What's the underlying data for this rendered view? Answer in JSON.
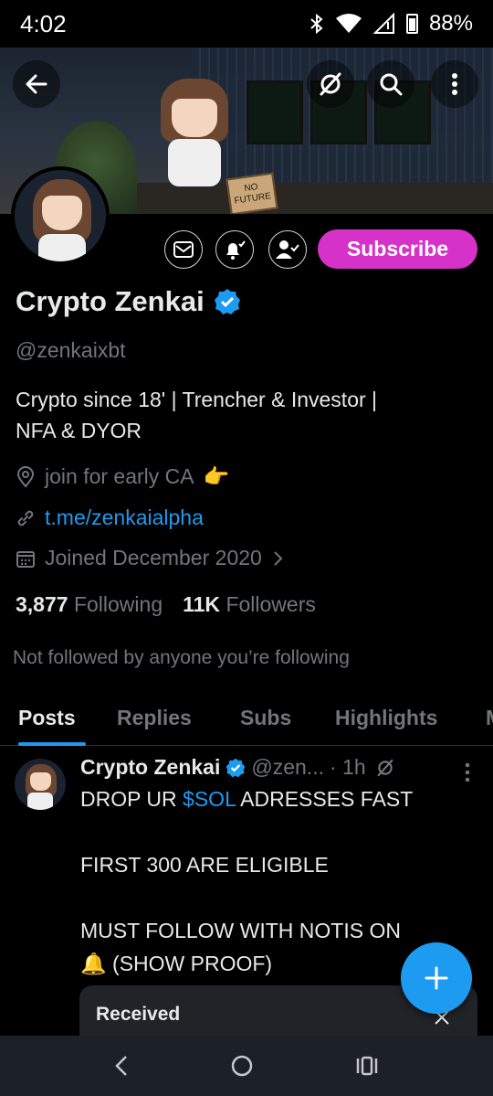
{
  "status_bar": {
    "time": "4:02",
    "battery": "88%",
    "icons": [
      "bluetooth-icon",
      "wifi-icon",
      "signal-icon",
      "battery-icon"
    ]
  },
  "banner": {
    "sign_text": "NO FUTURE",
    "icons": [
      "back-arrow-icon",
      "grok-slash-icon",
      "search-icon",
      "more-vertical-icon"
    ]
  },
  "profile": {
    "display_name": "Crypto Zenkai",
    "handle": "@zenkaixbt",
    "bio_line1": "Crypto since 18' | Trencher & Investor |",
    "bio_line2": "NFA & DYOR",
    "location_text": "join for early CA",
    "location_emoji": "👉",
    "link": "t.me/zenkaialpha",
    "joined": "Joined December 2020",
    "following_count": "3,877",
    "following_label": "Following",
    "followers_count": "11K",
    "followers_label": "Followers",
    "not_followed": "Not followed by anyone you’re following",
    "subscribe_label": "Subscribe",
    "verified_color": "#1d9bf0",
    "accent_color": "#d631c9"
  },
  "tabs": [
    {
      "label": "Posts",
      "active": true
    },
    {
      "label": "Replies",
      "active": false
    },
    {
      "label": "Subs",
      "active": false
    },
    {
      "label": "Highlights",
      "active": false
    },
    {
      "label": "M",
      "active": false
    }
  ],
  "post": {
    "author": "Crypto Zenkai",
    "handle": "@zen...",
    "time": "· 1h",
    "line1_pre": "DROP UR ",
    "line1_cashtag": "$SOL",
    "line1_post": " ADRESSES FAST",
    "line2": "FIRST 300 ARE ELIGIBLE",
    "line3": "MUST FOLLOW WITH NOTIS ON",
    "line4_emoji": "🔔",
    "line4": " (SHOW PROOF)",
    "card_label": "Received"
  },
  "fab": {
    "icon": "plus-icon"
  },
  "nav": {
    "icons": [
      "nav-back-icon",
      "nav-home-icon",
      "nav-recents-icon"
    ]
  }
}
